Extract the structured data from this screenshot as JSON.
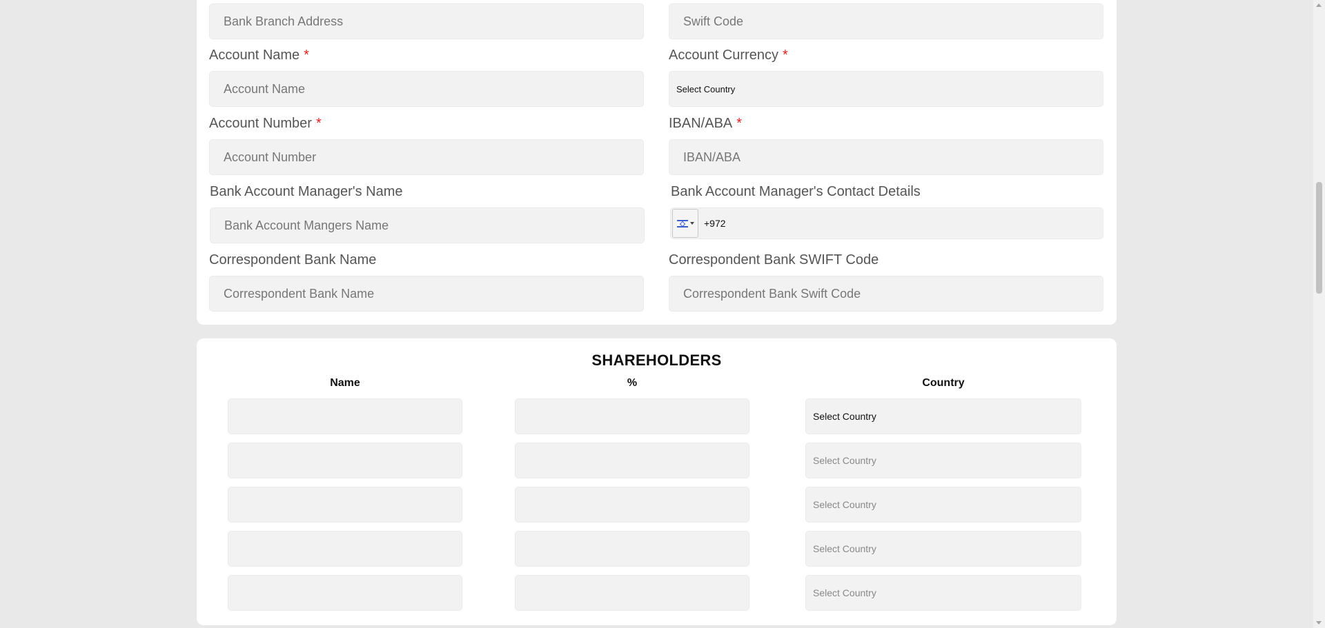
{
  "bank": {
    "bank_branch_address": {
      "placeholder": "Bank Branch Address"
    },
    "swift_code": {
      "placeholder": "Swift Code"
    },
    "account_name": {
      "label": "Account Name",
      "required_mark": "*",
      "placeholder": "Account Name"
    },
    "account_currency": {
      "label": "Account Currency",
      "required_mark": "*",
      "value": "Select Country"
    },
    "account_number": {
      "label": "Account Number",
      "required_mark": "*",
      "placeholder": "Account Number"
    },
    "iban_aba": {
      "label": "IBAN/ABA",
      "required_mark": "*",
      "placeholder": "IBAN/ABA"
    },
    "manager_name": {
      "label": "Bank Account Manager's Name",
      "placeholder": "Bank Account Mangers Name"
    },
    "manager_contact": {
      "label": "Bank Account Manager's Contact Details",
      "value": "+972",
      "flag_icon": "israel-flag-icon"
    },
    "correspondent_bank_name": {
      "label": "Correspondent Bank Name",
      "placeholder": "Correspondent Bank Name"
    },
    "correspondent_swift": {
      "label": "Correspondent Bank SWIFT Code",
      "placeholder": "Correspondent Bank Swift Code"
    }
  },
  "shareholders": {
    "title": "SHAREHOLDERS",
    "columns": [
      "Name",
      "%",
      "Country"
    ],
    "rows": [
      {
        "name": "",
        "percent": "",
        "country": "Select Country"
      },
      {
        "name": "",
        "percent": "",
        "country": "Select Country"
      },
      {
        "name": "",
        "percent": "",
        "country": "Select Country"
      },
      {
        "name": "",
        "percent": "",
        "country": "Select Country"
      },
      {
        "name": "",
        "percent": "",
        "country": "Select Country"
      }
    ]
  },
  "colors": {
    "required": "#e02020",
    "field_bg": "#f2f2f2",
    "page_bg": "#e9e9e9"
  }
}
